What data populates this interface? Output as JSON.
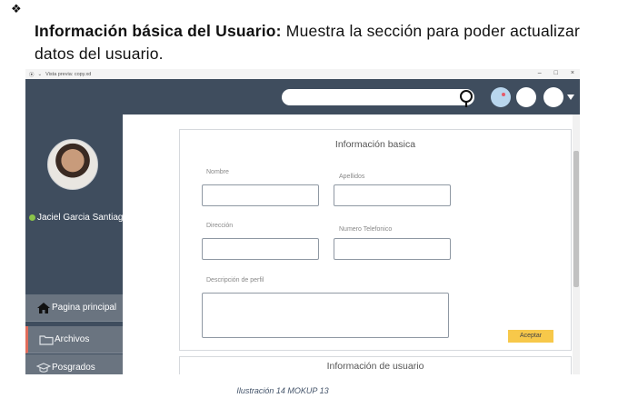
{
  "doc": {
    "bullet": "❖",
    "heading_bold": "Información básica del Usuario:",
    "heading_text": "Muestra la sección para poder actualizar datos del usuario.",
    "caption": "Ilustración 14 MOKUP 13"
  },
  "window": {
    "title": "Vista previa: copy.xd",
    "controls": [
      "–",
      "□",
      "×"
    ]
  },
  "sidebar": {
    "user_name": "Jaciel Garcia Santiag",
    "items": [
      {
        "label": "Pagina principal",
        "icon": "home-icon"
      },
      {
        "label": "Archivos",
        "icon": "folder-icon"
      },
      {
        "label": "Posgrados",
        "icon": "graduation-cap-icon"
      }
    ]
  },
  "form": {
    "title": "Información basica",
    "name_label": "Nombre",
    "surname_label": "Apellidos",
    "address_label": "Dirección",
    "phone_label": "Numero Telefonico",
    "description_label": "Descripción de perfil",
    "accept_label": "Aceptar"
  },
  "second_card": {
    "title": "Información de usuario"
  },
  "colors": {
    "header": "#3f4d5e",
    "nav_item": "#6a7480",
    "accent_button": "#f7c84a",
    "online": "#8bc34a"
  }
}
